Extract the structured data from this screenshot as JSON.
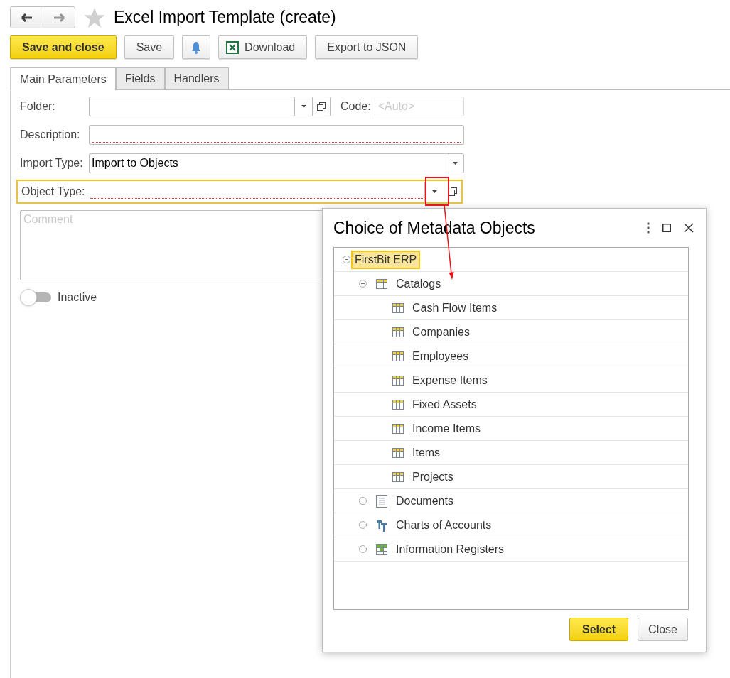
{
  "window": {
    "title": "Excel Import Template (create)",
    "favorite": false
  },
  "toolbar": [
    {
      "label": "Save and close",
      "kind": "primary"
    },
    {
      "label": "Save",
      "kind": "plain"
    },
    {
      "kind": "bell"
    },
    {
      "label": "Download",
      "kind": "excel"
    },
    {
      "label": "Export to JSON",
      "kind": "plain"
    }
  ],
  "tabs": [
    {
      "label": "Main Parameters",
      "selected": true
    },
    {
      "label": "Fields",
      "selected": false
    },
    {
      "label": "Handlers",
      "selected": false
    }
  ],
  "form": {
    "folder": {
      "label": "Folder:"
    },
    "code": {
      "label": "Code:",
      "placeholder": "<Auto>"
    },
    "description": {
      "label": "Description:",
      "required": true
    },
    "import_type": {
      "label": "Import Type:",
      "value": "Import to Objects"
    },
    "object_type": {
      "label": "Object Type:",
      "required": true,
      "focused": true
    },
    "comment": {
      "placeholder": "Comment"
    },
    "inactive": {
      "label": "Inactive",
      "on": false
    }
  },
  "dialog": {
    "title": "Choice of Metadata Objects",
    "tree": [
      {
        "label": "FirstBit ERP",
        "kind": "root",
        "expanded": true,
        "selected": true,
        "children": [
          {
            "label": "Catalogs",
            "kind": "catalog",
            "expanded": true,
            "selected": false,
            "children": [
              {
                "label": "Cash Flow Items",
                "kind": "catalog_item",
                "selected": false
              },
              {
                "label": "Companies",
                "kind": "catalog_item",
                "selected": false
              },
              {
                "label": "Employees",
                "kind": "catalog_item",
                "selected": false
              },
              {
                "label": "Expense Items",
                "kind": "catalog_item",
                "selected": false
              },
              {
                "label": "Fixed Assets",
                "kind": "catalog_item",
                "selected": false
              },
              {
                "label": "Income Items",
                "kind": "catalog_item",
                "selected": false
              },
              {
                "label": "Items",
                "kind": "catalog_item",
                "selected": false
              },
              {
                "label": "Projects",
                "kind": "catalog_item",
                "selected": false
              }
            ]
          },
          {
            "label": "Documents",
            "kind": "document",
            "expanded": false,
            "selected": false
          },
          {
            "label": "Charts of Accounts",
            "kind": "chart_of_accounts",
            "expanded": false,
            "selected": false
          },
          {
            "label": "Information Registers",
            "kind": "register",
            "expanded": false,
            "selected": false
          }
        ]
      }
    ],
    "buttons": [
      {
        "label": "Select",
        "kind": "primary"
      },
      {
        "label": "Close",
        "kind": "plain"
      }
    ]
  }
}
